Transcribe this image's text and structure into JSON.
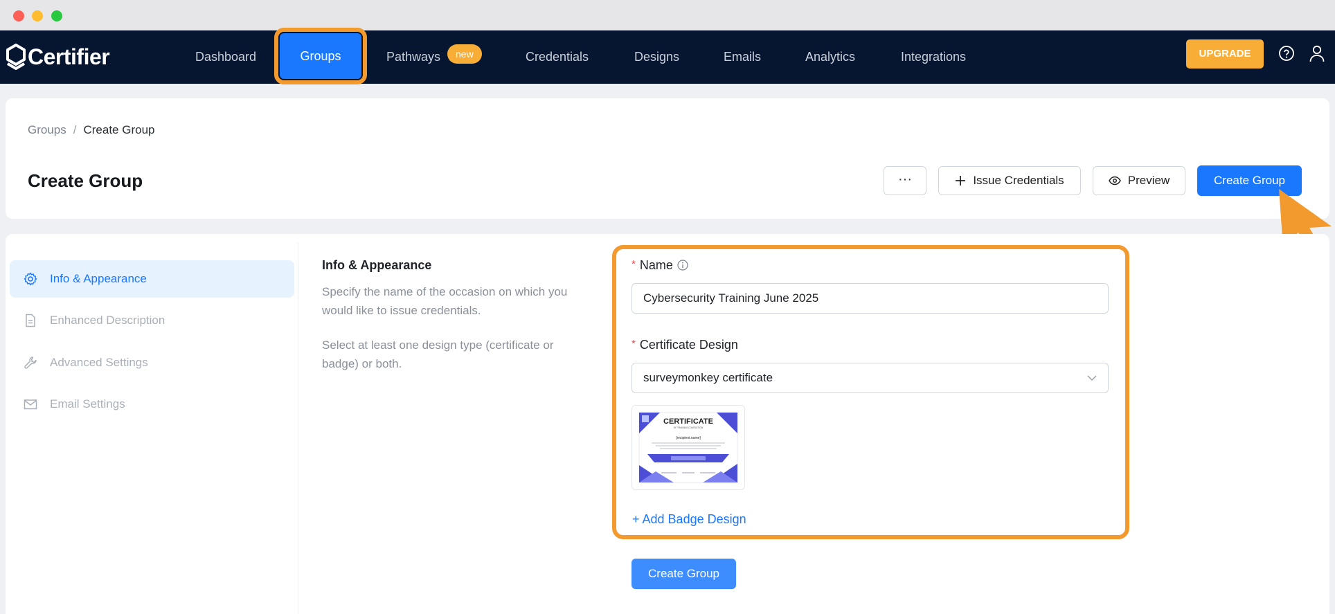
{
  "nav": {
    "brand": "Certifier",
    "items": [
      "Dashboard",
      "Groups",
      "Pathways",
      "Credentials",
      "Designs",
      "Emails",
      "Analytics",
      "Integrations"
    ],
    "new_badge": "new",
    "upgrade": "UPGRADE",
    "active": "Groups"
  },
  "breadcrumb": {
    "parent": "Groups",
    "separator": "/",
    "current": "Create Group"
  },
  "page": {
    "title": "Create Group",
    "more_label": "···",
    "issue_label": "Issue Credentials",
    "preview_label": "Preview",
    "create_label": "Create Group"
  },
  "sidebar": {
    "items": [
      {
        "label": "Info & Appearance",
        "icon": "gear-icon",
        "active": true
      },
      {
        "label": "Enhanced Description",
        "icon": "document-icon",
        "active": false
      },
      {
        "label": "Advanced Settings",
        "icon": "wrench-icon",
        "active": false
      },
      {
        "label": "Email Settings",
        "icon": "envelope-icon",
        "active": false
      }
    ]
  },
  "section": {
    "title": "Info & Appearance",
    "desc1": "Specify the name of the occasion on which you would like to issue credentials.",
    "desc2": "Select at least one design type (certificate or badge) or both."
  },
  "form": {
    "required_mark": "*",
    "name_label": "Name",
    "name_value": "Cybersecurity Training June 2025",
    "design_label": "Certificate Design",
    "design_value": "surveymonkey certificate",
    "add_badge": "+ Add Badge Design",
    "submit": "Create Group"
  },
  "thumbnail": {
    "title": "CERTIFICATE",
    "subtitle": "OF TRAINING COMPLETION",
    "recipient": "[recipient.name]"
  },
  "colors": {
    "nav_bg": "#061530",
    "accent": "#1a78ff",
    "upgrade": "#f8ad37",
    "highlight": "#f39a2e"
  }
}
